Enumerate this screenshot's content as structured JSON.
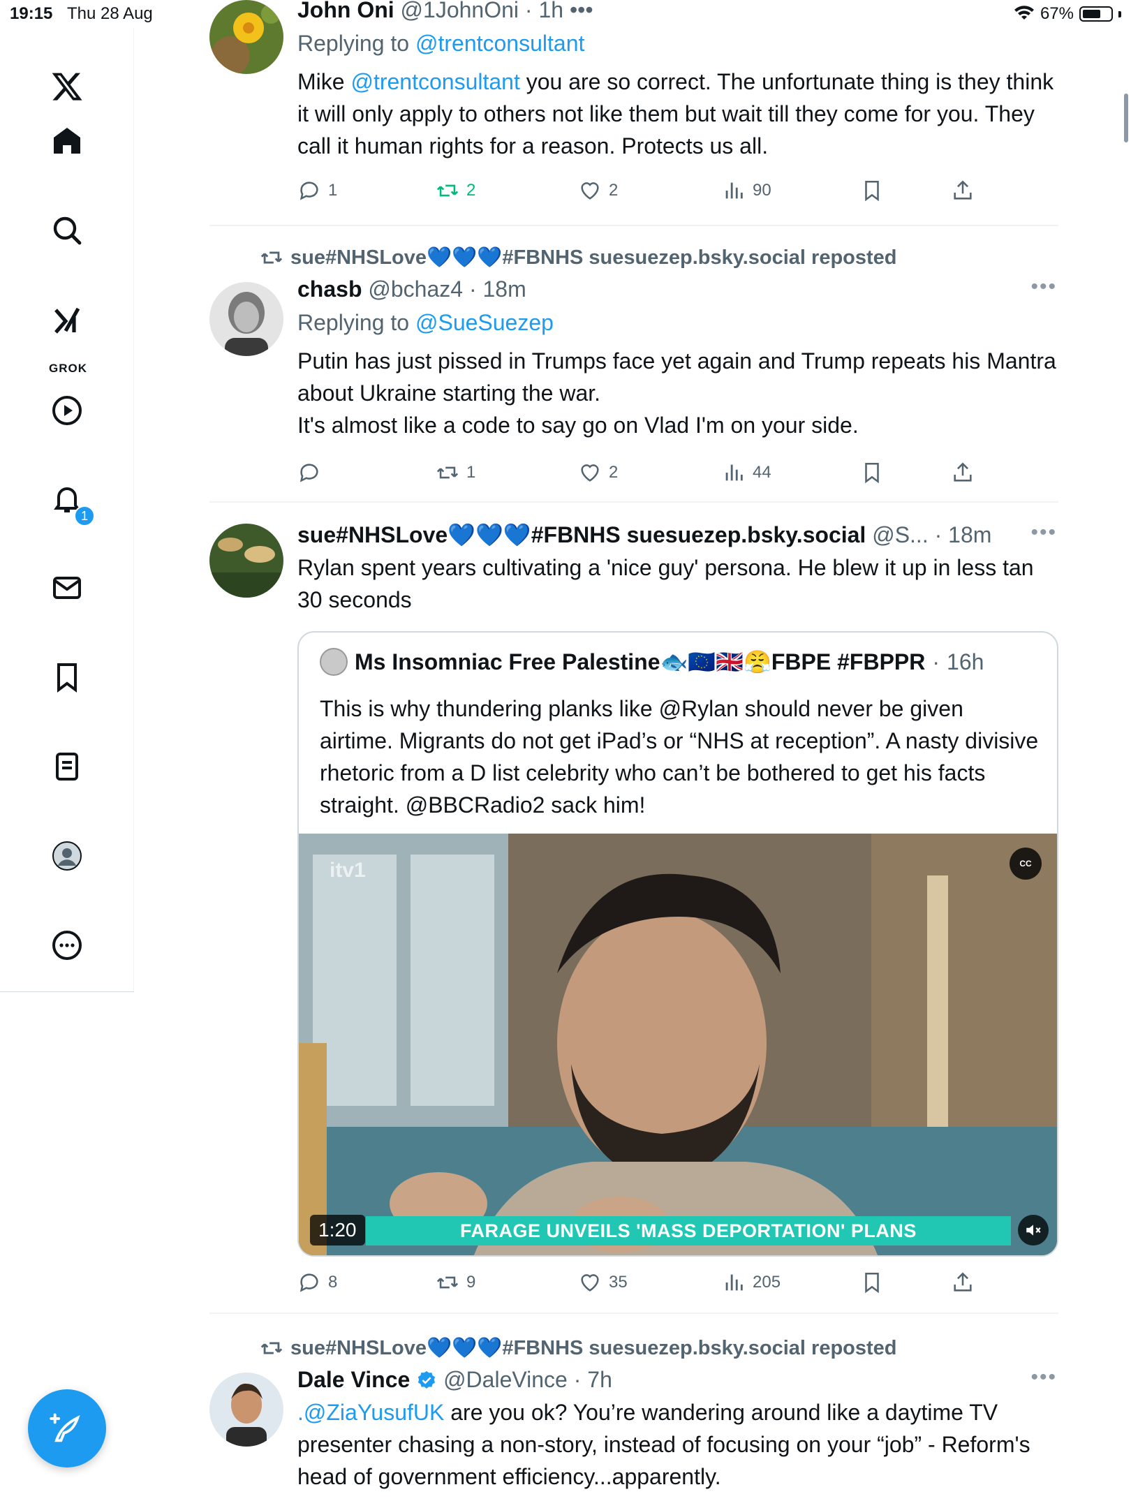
{
  "status_bar": {
    "time": "19:15",
    "date": "Thu 28 Aug",
    "battery": "67%",
    "battery_level": 0.67
  },
  "sidebar": {
    "items": [
      {
        "name": "x-logo"
      },
      {
        "name": "home"
      },
      {
        "name": "search"
      },
      {
        "name": "grok",
        "label": "GROK"
      },
      {
        "name": "video"
      },
      {
        "name": "notifications",
        "badge": "1"
      },
      {
        "name": "messages"
      },
      {
        "name": "bookmarks"
      },
      {
        "name": "lists"
      },
      {
        "name": "profile"
      },
      {
        "name": "more"
      }
    ]
  },
  "tweets": [
    {
      "name": "John Oni",
      "handle": "@1JohnOni",
      "time": "1h",
      "replying_label": "Replying to",
      "replying_to": "@trentconsultant",
      "text_parts": [
        "Mike ",
        "@trentconsultant",
        " you are so correct. The unfortunate thing is they think it will only apply to others not like them but wait till they come for you. They call it human rights for a reason. Protects us all."
      ],
      "replies": "1",
      "reposts": "2",
      "likes": "2",
      "views": "90"
    },
    {
      "repost_by": "sue#NHSLove💙💙💙#FBNHS suesuezep.bsky.social reposted",
      "name": "chasb",
      "handle": "@bchaz4",
      "time": "18m",
      "replying_label": "Replying to",
      "replying_to": "@SueSuezep",
      "text": "Putin has just pissed in Trumps face yet again and Trump repeats his Mantra about Ukraine starting the war.\nIt's almost like a code to say go on Vlad I'm on your side.",
      "replies": "",
      "reposts": "1",
      "likes": "2",
      "views": "44"
    },
    {
      "name": "sue#NHSLove💙💙💙#FBNHS suesuezep.bsky.social",
      "handle": "@S...",
      "time": "18m",
      "text": "Rylan spent years cultivating a 'nice guy' persona. He blew it up in less tan 30 seconds",
      "quote": {
        "name": "Ms Insomniac Free Palestine🐟🇪🇺🇬🇧😤FBPE #FBPPR",
        "time": "16h",
        "text": "This is why thundering planks like @Rylan should never be given airtime. Migrants do not get iPad’s or “NHS at reception”.  A nasty divisive rhetoric from a D list celebrity who can’t be bothered to get his facts straight. @BBCRadio2 sack him!",
        "video": {
          "duration": "1:20",
          "banner": "FARAGE UNVEILS 'MASS DEPORTATION' PLANS",
          "channel": "itv1",
          "cc": "CC"
        }
      },
      "replies": "8",
      "reposts": "9",
      "likes": "35",
      "views": "205"
    },
    {
      "repost_by": "sue#NHSLove💙💙💙#FBNHS suesuezep.bsky.social reposted",
      "name": "Dale Vince",
      "handle": "@DaleVince",
      "time": "7h",
      "text_parts": [
        ".@ZiaYusufUK",
        " are you ok? You’re wandering around like a daytime TV presenter chasing a non-story, instead of focusing on your “job” - Reform's head of government efficiency...apparently."
      ]
    }
  ],
  "colors": {
    "accent": "#1d9bf0",
    "repost_green": "#00ba7c",
    "muted": "#536471",
    "banner": "#22c7b3"
  }
}
